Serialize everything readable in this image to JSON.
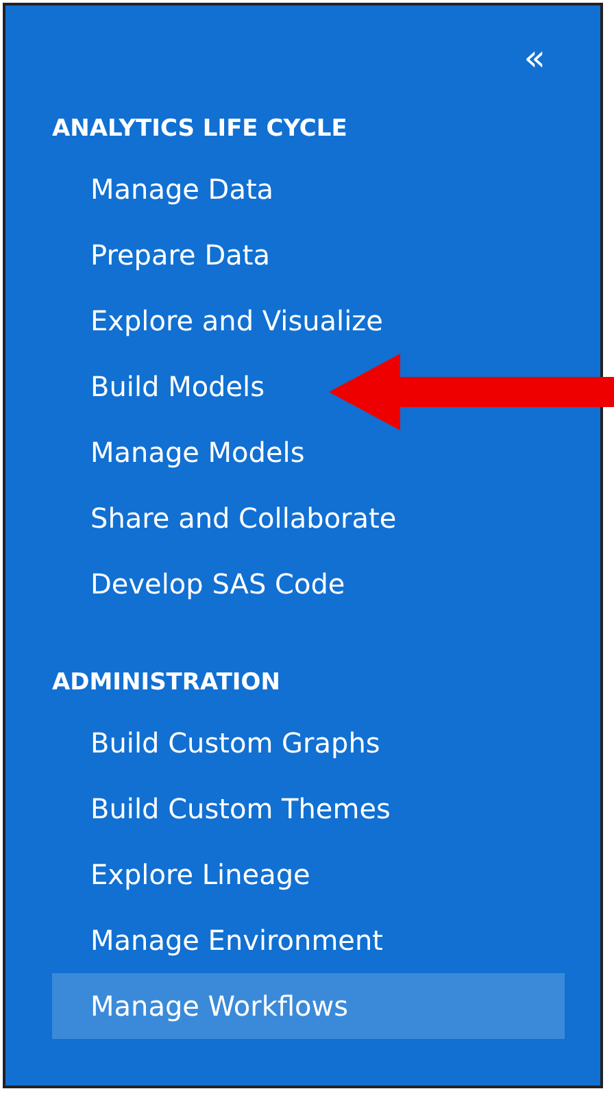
{
  "collapse_button": "«",
  "sections": [
    {
      "heading": "ANALYTICS LIFE CYCLE",
      "items": [
        {
          "label": "Manage Data",
          "selected": false
        },
        {
          "label": "Prepare Data",
          "selected": false
        },
        {
          "label": "Explore and Visualize",
          "selected": false
        },
        {
          "label": "Build Models",
          "selected": false
        },
        {
          "label": "Manage Models",
          "selected": false
        },
        {
          "label": "Share and Collaborate",
          "selected": false
        },
        {
          "label": "Develop SAS Code",
          "selected": false
        }
      ]
    },
    {
      "heading": "ADMINISTRATION",
      "items": [
        {
          "label": "Build Custom Graphs",
          "selected": false
        },
        {
          "label": "Build Custom Themes",
          "selected": false
        },
        {
          "label": "Explore Lineage",
          "selected": false
        },
        {
          "label": "Manage Environment",
          "selected": false
        },
        {
          "label": "Manage Workflows",
          "selected": true
        }
      ]
    }
  ]
}
